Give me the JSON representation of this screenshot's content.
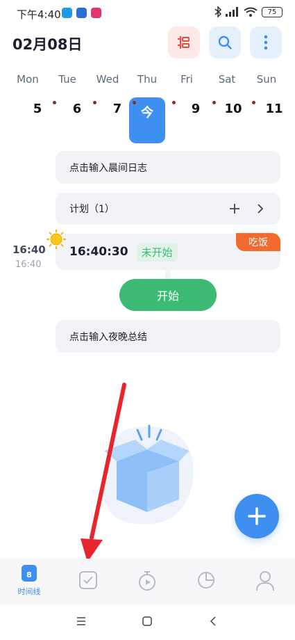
{
  "status_bar": {
    "time": "下午4:40",
    "battery": "75"
  },
  "header": {
    "date": "02月08日"
  },
  "week": {
    "days": [
      "Mon",
      "Tue",
      "Wed",
      "Thu",
      "Fri",
      "Sat",
      "Sun"
    ],
    "dates": [
      "5",
      "6",
      "7",
      "今",
      "9",
      "10",
      "11"
    ]
  },
  "cards": {
    "morning_log": "点击输入晨间日志",
    "plan_label": "计划（1）",
    "task_time_main": "16:40",
    "task_time_sub": "16:40",
    "task_clock": "16:40:30",
    "task_status": "未开始",
    "task_tag": "吃饭",
    "start_button": "开始",
    "night_summary": "点击输入夜晚总结"
  },
  "tabbar": {
    "timeline_label": "时间线",
    "calendar_badge": "8"
  },
  "colors": {
    "accent": "#3f8ff0",
    "start_green": "#3dba74",
    "tag_orange": "#f26a2e",
    "arrow_red": "#e8252c"
  }
}
